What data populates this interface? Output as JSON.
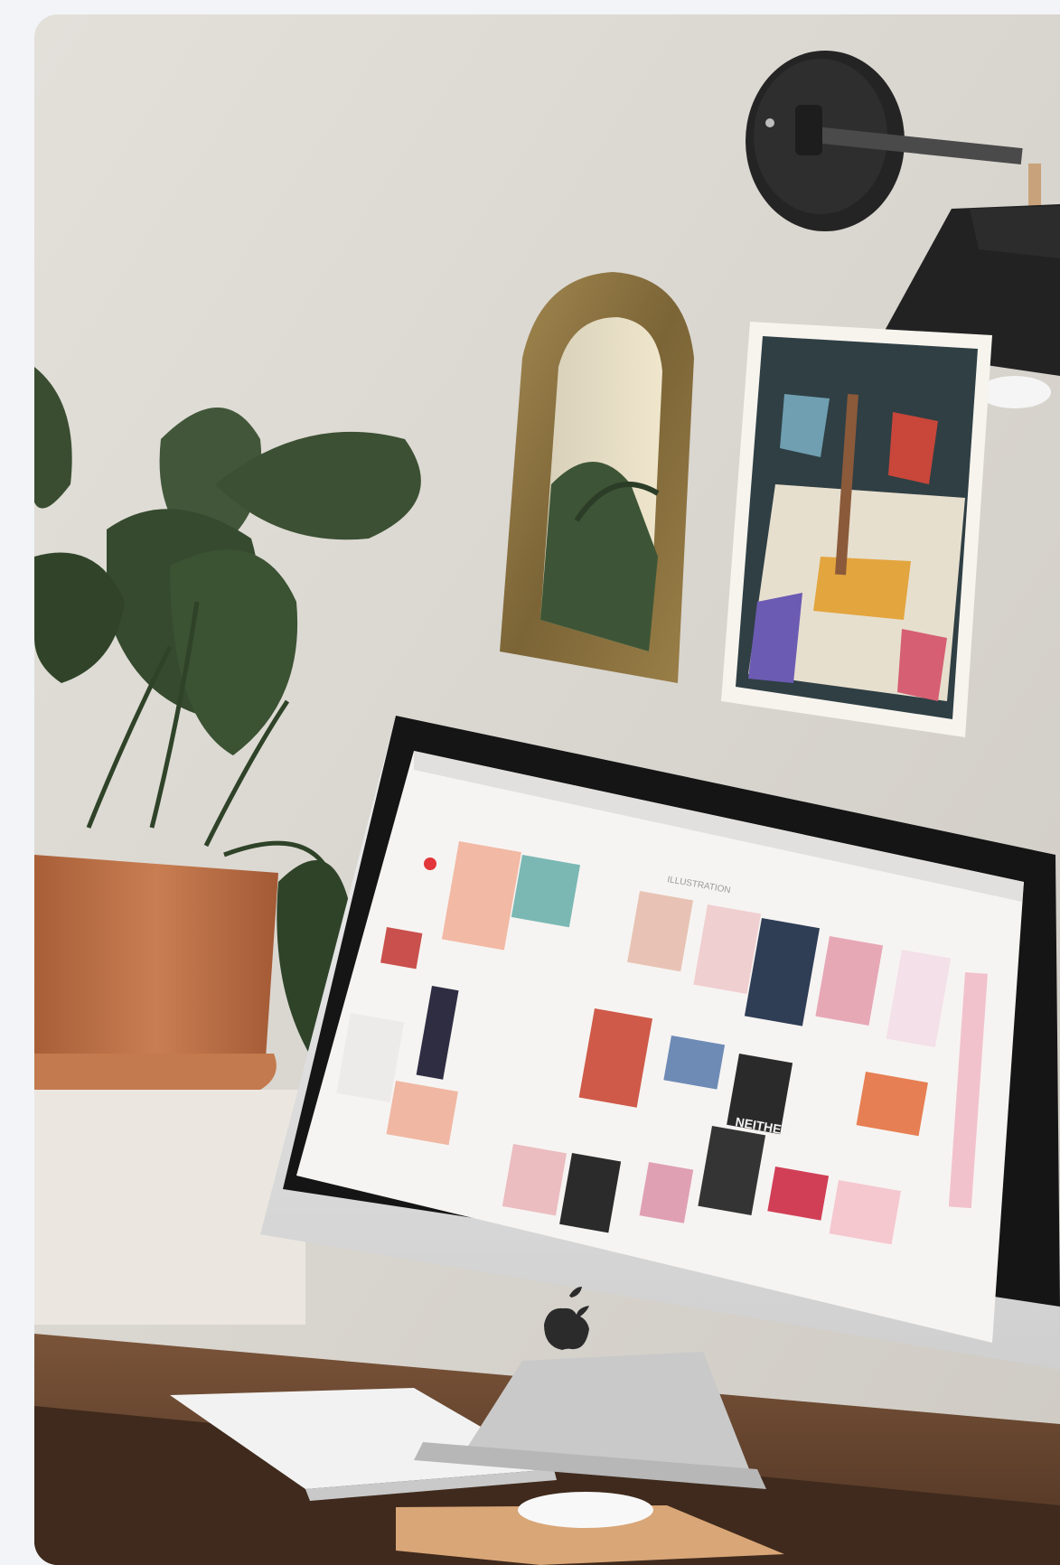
{
  "image": {
    "kind": "photograph",
    "subject": "home office desk with monitor, plant, mirror and wall art"
  },
  "screen": {
    "section_title": "ILLUSTRATION",
    "poster_text": "NEITHER"
  },
  "colors": {
    "page_bg": "#f2f4f7",
    "wall": "#dcd9d3",
    "desk": "#6b4a34",
    "pot": "#c57b4f",
    "leaf": "#3c4f33",
    "lamp": "#2a2a2a",
    "mirror_frame": "#8b7445",
    "monitor_silver": "#dcdcdc",
    "bezel": "#1a1a1a"
  },
  "icons": {
    "logo": "apple-logo-icon",
    "screen_badge": "plus-circle-icon"
  }
}
